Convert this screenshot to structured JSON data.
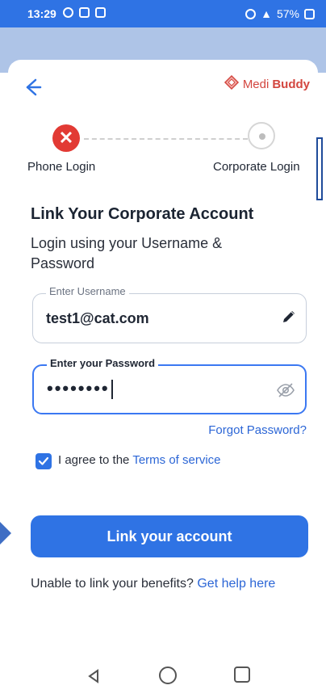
{
  "status_bar": {
    "time": "13:29",
    "left_icons": [
      "whatsapp-icon",
      "sheets-icon",
      "gmail-icon"
    ],
    "battery_percent": "57%",
    "right_icons": [
      "alarm-icon",
      "data-speed-icon",
      "wifi-icon",
      "sim-icon",
      "signal-icon",
      "battery-icon"
    ]
  },
  "header": {
    "back_icon": "back-arrow-icon",
    "logo": {
      "prefix": "Medi",
      "suffix": "Buddy",
      "icon": "medibuddy-logo-icon"
    }
  },
  "stepper": {
    "steps": [
      {
        "label": "Phone Login",
        "state": "error"
      },
      {
        "label": "Corporate Login",
        "state": "pending"
      }
    ]
  },
  "form": {
    "title": "Link Your Corporate Account",
    "subtitle": "Login using your Username & Password",
    "username": {
      "label": "Enter Username",
      "value": "test1@cat.com"
    },
    "password": {
      "label": "Enter your Password",
      "value": "••••••••"
    },
    "forgot_password": "Forgot Password?",
    "agree": {
      "prefix": "I agree to the",
      "link": "Terms of service",
      "checked": true
    },
    "submit_label": "Link your account",
    "help": {
      "prefix": "Unable to link your benefits?",
      "link": "Get help here"
    }
  },
  "colors": {
    "primary": "#2f73e4",
    "error": "#e23a34",
    "brand": "#d3463f",
    "link": "#2c66d6"
  },
  "nav": {
    "icons": [
      "nav-back-icon",
      "home-icon",
      "recents-icon"
    ]
  }
}
